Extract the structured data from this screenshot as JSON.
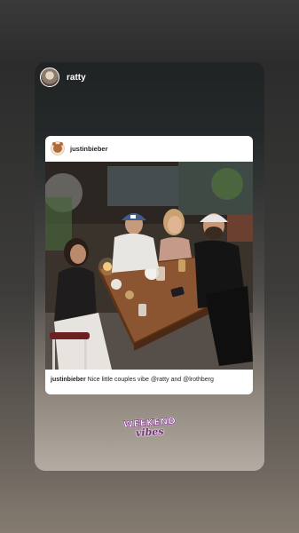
{
  "story": {
    "username": "ratty"
  },
  "post": {
    "username": "justinbieber",
    "caption": {
      "user": "justinbieber",
      "text": "Nice little couples vibe @ratty and  @lrothberg"
    }
  },
  "sticker": {
    "line1": "WEEKEND",
    "line2": "vibes"
  },
  "colors": {
    "sticker_accent": "#7b2e7e"
  }
}
